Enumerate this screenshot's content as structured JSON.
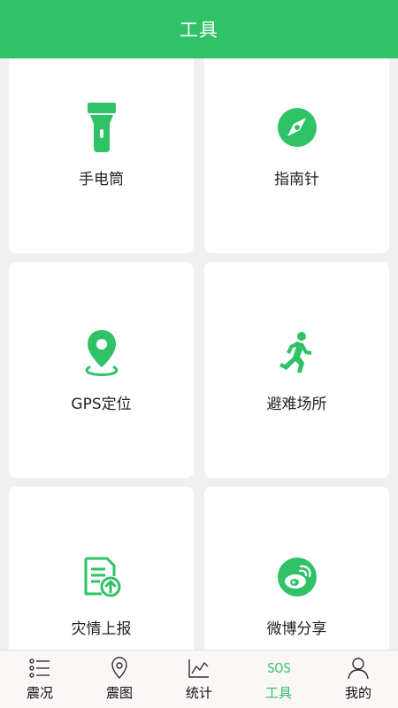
{
  "header": {
    "title": "工具"
  },
  "tools": [
    {
      "label": "手电筒",
      "icon": "flashlight-icon"
    },
    {
      "label": "指南针",
      "icon": "compass-icon"
    },
    {
      "label": "GPS定位",
      "icon": "location-pin-icon"
    },
    {
      "label": "避难场所",
      "icon": "running-person-icon"
    },
    {
      "label": "灾情上报",
      "icon": "report-upload-icon"
    },
    {
      "label": "微博分享",
      "icon": "weibo-icon"
    }
  ],
  "tabbar": {
    "items": [
      {
        "label": "震况",
        "icon": "list-icon"
      },
      {
        "label": "震图",
        "icon": "map-pin-icon"
      },
      {
        "label": "统计",
        "icon": "chart-icon"
      },
      {
        "label": "工具",
        "icon": "sos-icon",
        "icon_text": "SOS",
        "active": true
      },
      {
        "label": "我的",
        "icon": "user-icon"
      }
    ]
  },
  "colors": {
    "accent": "#2fc266",
    "background": "#f0f0f0",
    "card": "#ffffff"
  }
}
